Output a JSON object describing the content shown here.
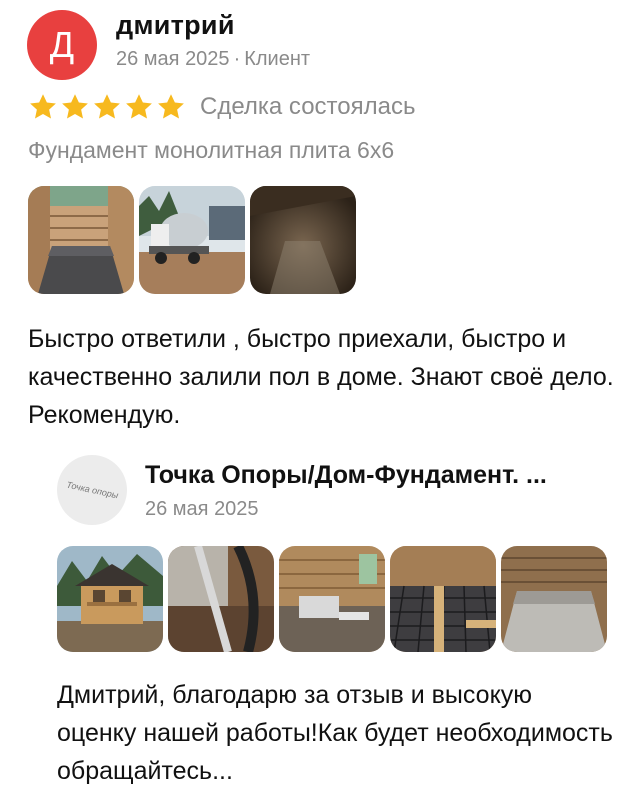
{
  "review": {
    "avatar_letter": "Д",
    "avatar_color": "#e8403f",
    "author": "дмитрий",
    "date": "26 мая 2025",
    "separator": "·",
    "role": "Клиент",
    "rating": 5,
    "star_color": "#f7b91e",
    "deal_status": "Сделка состоялась",
    "subject": "Фундамент монолитная плита 6х6",
    "photos": [
      {
        "name": "review-photo-floor-slab",
        "icon": "photo"
      },
      {
        "name": "review-photo-concrete-mixer",
        "icon": "photo"
      },
      {
        "name": "review-photo-dark-room",
        "icon": "photo"
      }
    ],
    "text": "Быстро ответили , быстро приехали, быстро и качественно залили пол в доме. Знают своё дело. Рекомендую."
  },
  "reply": {
    "avatar_text": "Точка опоры",
    "author": "Точка Опоры/Дом-Фундамент. ...",
    "date": "26 мая 2025",
    "photos": [
      {
        "name": "reply-photo-wooden-house",
        "icon": "photo"
      },
      {
        "name": "reply-photo-pipe-ground",
        "icon": "photo"
      },
      {
        "name": "reply-photo-interior-work",
        "icon": "photo"
      },
      {
        "name": "reply-photo-rebar-mesh",
        "icon": "photo"
      },
      {
        "name": "reply-photo-finished-room",
        "icon": "photo"
      }
    ],
    "text": "Дмитрий, благодарю за отзыв и высокую оценку нашей работы!Как будет необходимость обращайтесь..."
  }
}
